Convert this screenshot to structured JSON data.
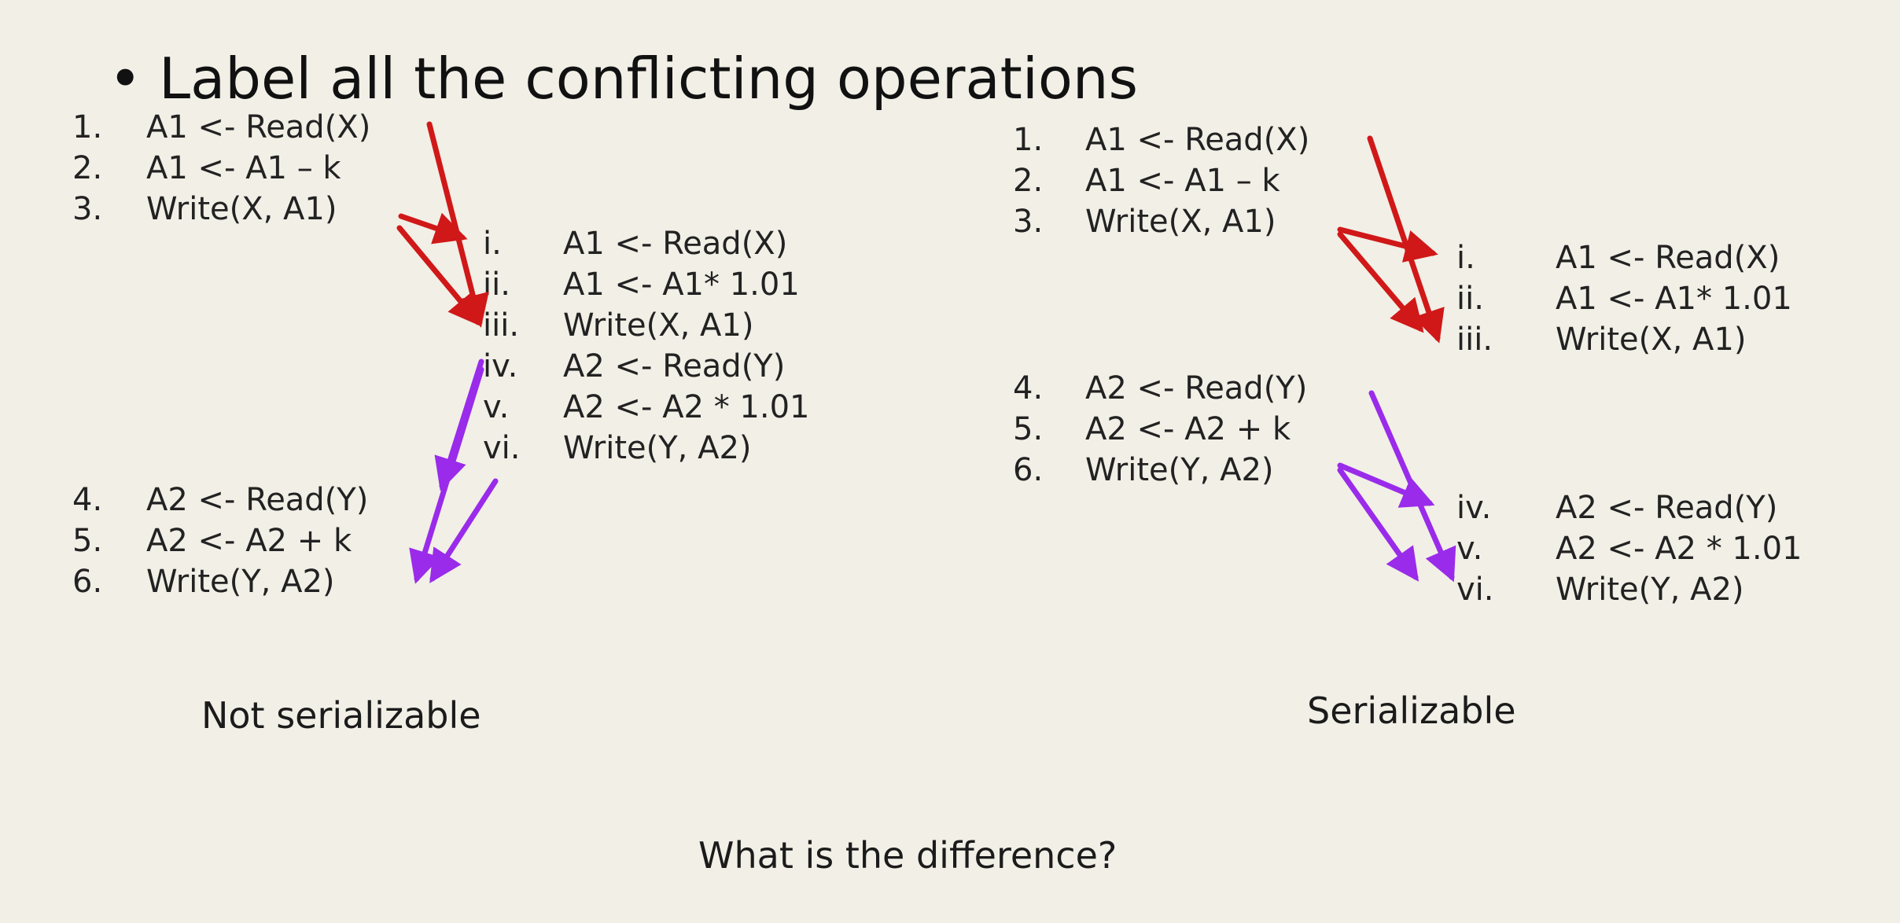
{
  "title": {
    "bullet": "•",
    "text": "Label all the conflicting operations"
  },
  "left_panel": {
    "t1_first": [
      {
        "num": "1.",
        "text": "A1 <- Read(X)"
      },
      {
        "num": "2.",
        "text": "A1 <- A1 – k"
      },
      {
        "num": "3.",
        "text": "Write(X, A1)"
      }
    ],
    "t2": [
      {
        "num": "i.",
        "text": "A1 <- Read(X)"
      },
      {
        "num": "ii.",
        "text": "A1 <- A1* 1.01"
      },
      {
        "num": "iii.",
        "text": "Write(X, A1)"
      },
      {
        "num": "iv.",
        "text": "A2 <- Read(Y)"
      },
      {
        "num": "v.",
        "text": "A2 <- A2 * 1.01"
      },
      {
        "num": "vi.",
        "text": "Write(Y, A2)"
      }
    ],
    "t1_second": [
      {
        "num": "4.",
        "text": "A2 <- Read(Y)"
      },
      {
        "num": "5.",
        "text": "A2 <- A2 + k"
      },
      {
        "num": "6.",
        "text": "Write(Y, A2)"
      }
    ],
    "caption": "Not serializable"
  },
  "right_panel": {
    "t1_first": [
      {
        "num": "1.",
        "text": "A1 <- Read(X)"
      },
      {
        "num": "2.",
        "text": "A1 <- A1 – k"
      },
      {
        "num": "3.",
        "text": "Write(X, A1)"
      }
    ],
    "t2_first": [
      {
        "num": "i.",
        "text": "A1 <- Read(X)"
      },
      {
        "num": "ii.",
        "text": "A1 <- A1* 1.01"
      },
      {
        "num": "iii.",
        "text": "Write(X, A1)"
      }
    ],
    "t1_second": [
      {
        "num": "4.",
        "text": "A2 <- Read(Y)"
      },
      {
        "num": "5.",
        "text": "A2 <- A2 + k"
      },
      {
        "num": "6.",
        "text": "Write(Y, A2)"
      }
    ],
    "t2_second": [
      {
        "num": "iv.",
        "text": "A2 <- Read(Y)"
      },
      {
        "num": "v.",
        "text": "A2 <- A2 * 1.01"
      },
      {
        "num": "vi.",
        "text": "Write(Y, A2)"
      }
    ],
    "caption": "Serializable"
  },
  "question": "What is the difference?",
  "colors": {
    "background": "#f1efe6",
    "conflict_x": "#d01818",
    "conflict_y": "#9a2bea"
  }
}
